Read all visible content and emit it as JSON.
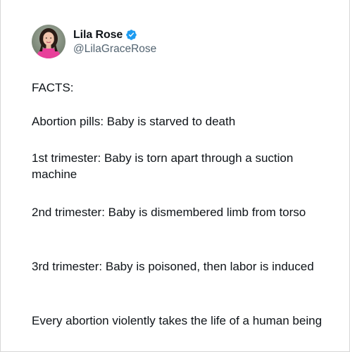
{
  "author": {
    "display_name": "Lila Rose",
    "handle": "@LilaGraceRose",
    "verified_color": "#1d9bf0"
  },
  "icons": {
    "avatar": "profile-photo",
    "verified": "verified-badge-icon"
  },
  "tweet": {
    "paragraphs": [
      "FACTS:",
      "Abortion pills: Baby is starved to death",
      "1st trimester: Baby is torn apart through a suction machine",
      "2nd trimester: Baby is dismembered limb from torso",
      "3rd trimester: Baby is poisoned, then labor is induced",
      "Every abortion violently takes the life of a human being"
    ]
  },
  "colors": {
    "text": "#0f1419",
    "secondary_text": "#536471",
    "background": "#ffffff"
  }
}
